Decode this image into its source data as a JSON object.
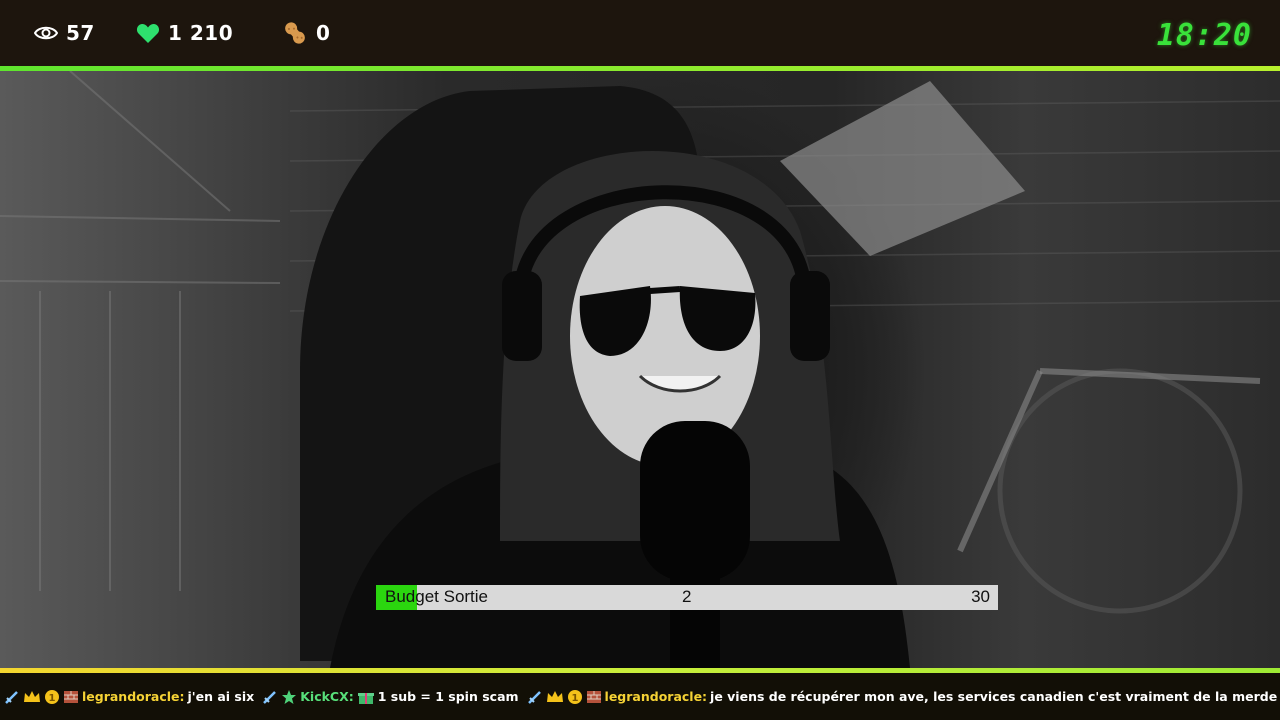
{
  "stats": {
    "viewers": "57",
    "likes": "1 210",
    "peanuts": "0",
    "viewers_icon": "eye-icon",
    "likes_icon": "heart-icon",
    "peanuts_icon": "peanut-icon"
  },
  "clock": "18:20",
  "budget": {
    "label": "Budget Sortie",
    "current": "2",
    "goal": "30",
    "progress_fraction": 0.0667
  },
  "chat": [
    {
      "user": "legrandoracle:",
      "text": "j'en ai six",
      "badges": [
        "sword-icon",
        "crown-icon",
        "coin-icon",
        "brick-icon"
      ]
    },
    {
      "user": "KickCX:",
      "text": "1 sub = 1 spin scam",
      "badges": [
        "sword-icon",
        "star-icon",
        "gift-icon"
      ]
    },
    {
      "user": "legrandoracle:",
      "text": "je viens de récupérer mon ave, les services canadien c'est vraiment de la merde les gars",
      "badges": [
        "sword-icon",
        "crown-icon",
        "coin-icon",
        "brick-icon"
      ]
    }
  ],
  "colors": {
    "accent_green": "#39e23a",
    "bar_fill": "#2bd60f",
    "username_yellow": "#f5d235",
    "username_green": "#58e07a"
  }
}
